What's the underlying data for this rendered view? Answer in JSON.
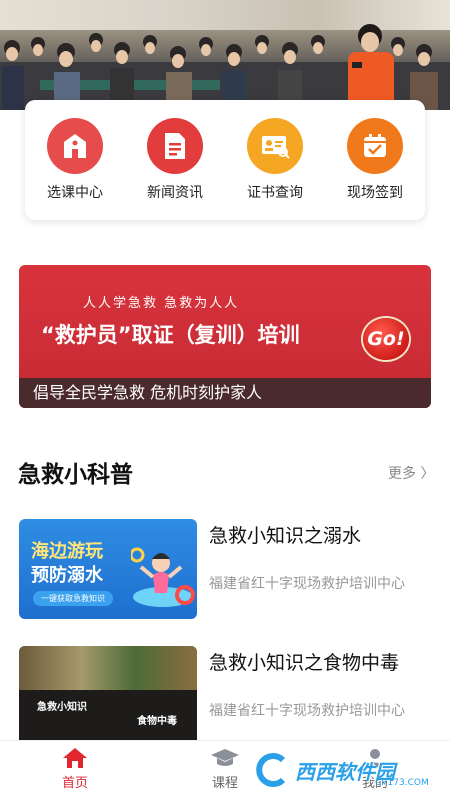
{
  "hero": {
    "photo_icon": "training-audience-photo"
  },
  "quick_menu": [
    {
      "label": "选课中心",
      "icon": "school-icon",
      "color": "#e74c4c"
    },
    {
      "label": "新闻资讯",
      "icon": "document-icon",
      "color": "#e23c3c"
    },
    {
      "label": "证书查询",
      "icon": "certificate-search-icon",
      "color": "#f5a623"
    },
    {
      "label": "现场签到",
      "icon": "calendar-check-icon",
      "color": "#f07a1b"
    }
  ],
  "banner": {
    "tagline": "人人学急救 急救为人人",
    "headline": "“救护员”取证（复训）培训",
    "go": "Go!",
    "footer": "倡导全民学急救 危机时刻护家人",
    "color": "#d8333d"
  },
  "section": {
    "title": "急救小科普",
    "more": "更多 〉"
  },
  "articles": [
    {
      "title": "急救小知识之溺水",
      "source": "福建省红十字现场救护培训中心",
      "thumb_line1": "海边游玩",
      "thumb_line2": "预防溺水",
      "thumb_button": "一键获取急救知识"
    },
    {
      "title": "急救小知识之食物中毒",
      "source": "福建省红十字现场救护培训中心",
      "thumb_left": "急救小知识",
      "thumb_right": "食物中毒"
    }
  ],
  "tabs": [
    {
      "label": "首页",
      "icon": "home-icon",
      "active": true
    },
    {
      "label": "课程",
      "icon": "graduation-cap-icon",
      "active": false
    },
    {
      "label": "我的",
      "icon": "user-icon",
      "active": false
    }
  ],
  "watermark": {
    "text": "西西软件园",
    "sub": "CR173.COM"
  },
  "colors": {
    "accent": "#e0262e"
  }
}
